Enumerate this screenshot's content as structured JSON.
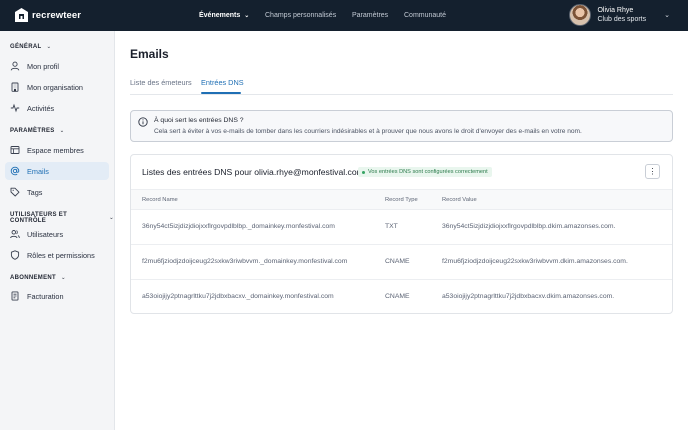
{
  "header": {
    "brand": "recrewteer",
    "nav": [
      {
        "label": "Événements",
        "active": true,
        "has_dropdown": true
      },
      {
        "label": "Champs personnalisés",
        "active": false
      },
      {
        "label": "Paramètres",
        "active": false
      },
      {
        "label": "Communauté",
        "active": false
      }
    ],
    "user": {
      "name": "Olivia Rhye",
      "role": "Club des sports"
    }
  },
  "sidebar": {
    "sections": [
      {
        "title": "GÉNÉRAL",
        "items": [
          {
            "label": "Mon profil",
            "icon": "user-icon"
          },
          {
            "label": "Mon organisation",
            "icon": "building-icon"
          },
          {
            "label": "Activités",
            "icon": "activity-icon"
          }
        ]
      },
      {
        "title": "PARAMÈTRES",
        "items": [
          {
            "label": "Espace membres",
            "icon": "layout-icon"
          },
          {
            "label": "Emails",
            "icon": "at-sign-icon",
            "active": true
          },
          {
            "label": "Tags",
            "icon": "tag-icon"
          }
        ]
      },
      {
        "title": "UTILISATEURS ET CONTRÔLE",
        "items": [
          {
            "label": "Utilisateurs",
            "icon": "users-icon"
          },
          {
            "label": "Rôles et permissions",
            "icon": "shield-icon"
          }
        ]
      },
      {
        "title": "ABONNEMENT",
        "items": [
          {
            "label": "Facturation",
            "icon": "invoice-icon"
          }
        ]
      }
    ]
  },
  "main": {
    "title": "Emails",
    "tabs": [
      {
        "label": "Liste des émeteurs",
        "active": false
      },
      {
        "label": "Entrées DNS",
        "active": true
      }
    ],
    "info": {
      "title": "À quoi sert les entrées DNS ?",
      "text": "Cela sert à éviter à vos e-mails de tomber dans les courriers indésirables et à prouver que nous avons le droit d'envoyer des e-mails en votre nom."
    },
    "dns_card": {
      "title": "Listes des entrées DNS pour olivia.rhye@monfestival.com",
      "badge": "Vos entrées DNS sont configurées correctement",
      "columns": [
        "Record Name",
        "Record Type",
        "Record Value"
      ],
      "rows": [
        {
          "name": "36ny54ct5izjdizjdiojxxflrgovpdlblbp._domainkey.monfestival.com",
          "type": "TXT",
          "value": "36ny54ct5izjdizjdiojxxflrgovpdlblbp.dkim.amazonses.com."
        },
        {
          "name": "f2mu6fjziodjzdoijceug22sxkw3riwbvvm._domainkey.monfestival.com",
          "type": "CNAME",
          "value": "f2mu6fjziodjzdoijceug22sxkw3riwbvvm.dkim.amazonses.com."
        },
        {
          "name": "a53oiojijy2ptnagrlttku7j2jdbxbacxv._domainkey.monfestival.com",
          "type": "CNAME",
          "value": "a53oiojijy2ptnagrlttku7j2jdbxbacxv.dkim.amazonses.com."
        }
      ]
    }
  },
  "colors": {
    "topbar": "#14202e",
    "accent": "#1f6fb4",
    "success": "#35a463"
  }
}
